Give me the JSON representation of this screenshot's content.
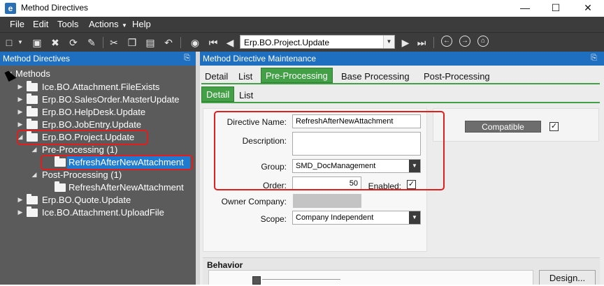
{
  "window": {
    "title": "Method Directives",
    "app_icon": "e",
    "controls": [
      "minimize-icon",
      "maximize-icon",
      "close-icon"
    ]
  },
  "menu": {
    "items": [
      "File",
      "Edit",
      "Tools",
      "Actions",
      "Help"
    ]
  },
  "toolbar": {
    "method_value": "Erp.BO.Project.Update",
    "icons": [
      "new-icon",
      "save-icon",
      "delete-icon",
      "refresh-icon",
      "clear-icon",
      "cut-icon",
      "copy-icon",
      "paste-icon",
      "undo-icon",
      "binoculars-icon",
      "first-record-icon",
      "previous-record-icon",
      "next-record-icon",
      "last-record-icon",
      "back-icon",
      "forward-icon",
      "home-icon"
    ]
  },
  "left_panel": {
    "title": "Method Directives",
    "pin": "\u0000",
    "tree": {
      "root": "Methods",
      "items": [
        "Ice.BO.Attachment.FileExists",
        "Erp.BO.SalesOrder.MasterUpdate",
        "Erp.BO.HelpDesk.Update",
        "Erp.BO.JobEntry.Update",
        "Erp.BO.Project.Update",
        "Pre-Processing (1)",
        "RefreshAfterNewAttachment",
        "Post-Processing (1)",
        "RefreshAfterNewAttachment",
        "Erp.BO.Quote.Update",
        "Ice.BO.Attachment.UploadFile"
      ]
    }
  },
  "right_panel": {
    "title": "Method Directive Maintenance",
    "tabs": [
      "Detail",
      "List",
      "Pre-Processing",
      "Base Processing",
      "Post-Processing"
    ],
    "active_tab": "Pre-Processing",
    "subtabs": [
      "Detail",
      "List"
    ],
    "active_subtab": "Detail",
    "form": {
      "directive_name_label": "Directive Name:",
      "directive_name_value": "RefreshAfterNewAttachment",
      "description_label": "Description:",
      "description_value": "",
      "group_label": "Group:",
      "group_value": "SMD_DocManagement",
      "order_label": "Order:",
      "order_value": "50",
      "enabled_label": "Enabled:",
      "enabled_checked": true,
      "owner_company_label": "Owner Company:",
      "scope_label": "Scope:",
      "scope_value": "Company Independent"
    },
    "compatible_button": "Compatible",
    "compatible_checked": true,
    "behavior_label": "Behavior",
    "design_button": "Design..."
  },
  "colors": {
    "accent_green": "#43a047",
    "header_blue": "#1e6fbf",
    "annotation_red": "#e01e1e",
    "tree_bg": "#5b5b5b",
    "selection_blue": "#1e7bd0"
  }
}
